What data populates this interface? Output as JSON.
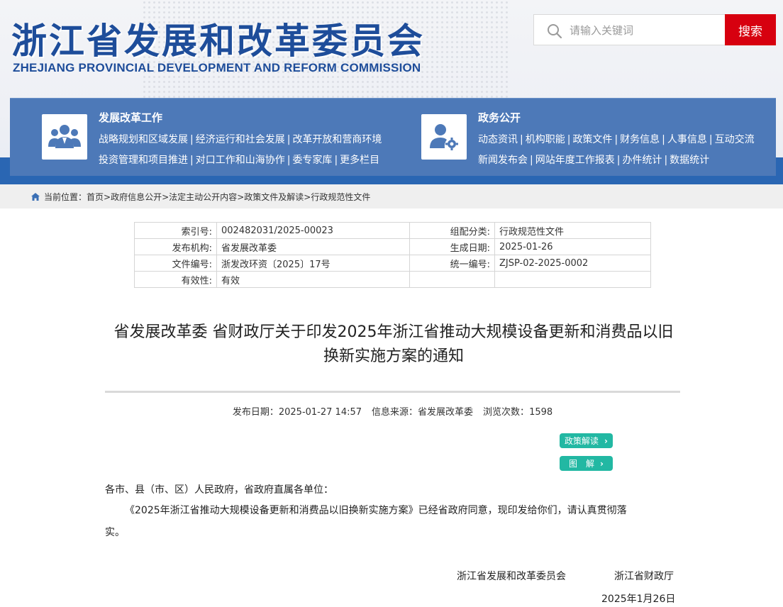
{
  "header": {
    "logo_cn": "浙江省发展和改革委员会",
    "logo_en": "ZHEJIANG PROVINCIAL DEVELOPMENT AND REFORM COMMISSION",
    "search_placeholder": "请输入关键词",
    "search_button": "搜索",
    "brand_color": "#1e4d9a",
    "accent_red": "#d7000f"
  },
  "nav": {
    "left": {
      "icon": "people-group-icon",
      "title": "发展改革工作",
      "row1": [
        "战略规划和区域发展",
        "经济运行和社会发展",
        "改革开放和营商环境"
      ],
      "row2": [
        "投资管理和项目推进",
        "对口工作和山海协作",
        "委专家库",
        "更多栏目"
      ]
    },
    "right": {
      "icon": "user-gear-icon",
      "title": "政务公开",
      "row1": [
        "动态资讯",
        "机构职能",
        "政策文件",
        "财务信息",
        "人事信息",
        "互动交流"
      ],
      "row2": [
        "新闻发布会",
        "网站年度工作报表",
        "办件统计",
        "数据统计"
      ]
    },
    "separator": "|"
  },
  "breadcrumb": {
    "label": "当前位置：",
    "items": [
      "首页",
      "政府信息公开",
      "法定主动公开内容",
      "政策文件及解读",
      "行政规范性文件"
    ],
    "separator": ">"
  },
  "meta": {
    "rows": [
      {
        "k1": "索引号:",
        "v1": "002482031/2025-00023",
        "k2": "组配分类:",
        "v2": "行政规范性文件"
      },
      {
        "k1": "发布机构:",
        "v1": "省发展改革委",
        "k2": "生成日期:",
        "v2": "2025-01-26"
      },
      {
        "k1": "文件编号:",
        "v1": "浙发改环资〔2025〕17号",
        "k2": "统一编号:",
        "v2": "ZJSP-02-2025-0002"
      },
      {
        "k1": "有效性:",
        "v1": "有效",
        "k2": "",
        "v2": ""
      }
    ]
  },
  "doc": {
    "title_line1": "省发展改革委 省财政厅关于印发2025年浙江省推动大规模设备更新和消费品以旧",
    "title_line2": "换新实施方案的通知",
    "publish_label": "发布日期：",
    "publish_date": "2025-01-27 14:57",
    "source_label": "信息来源：",
    "source": "省发展改革委",
    "views_label": "浏览次数：",
    "views": "1598",
    "policy_btn": "政策解读",
    "diagram_btn": "图　解",
    "salutation": "各市、县（市、区）人民政府，省政府直属各单位：",
    "para1_line1": "《2025年浙江省推动大规模设备更新和消费品以旧换新实施方案》已经省政府同意，现印发给你们，请认真贯彻落",
    "para1_line2": "实。",
    "signer1": "浙江省发展和改革委员会",
    "signer2": "浙江省财政厅",
    "sign_date": "2025年1月26日",
    "pill_color": "#22b8a3"
  }
}
